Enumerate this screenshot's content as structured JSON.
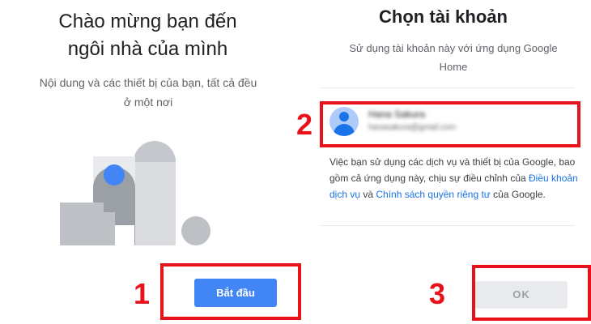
{
  "welcome": {
    "title_line1": "Chào mừng bạn đến",
    "title_line2": "ngôi nhà của mình",
    "subtitle_line1": "Nội dung và các thiết bị của bạn, tất cả đều",
    "subtitle_line2": "ở một nơi",
    "start_button": "Bắt đầu"
  },
  "choose_account": {
    "title": "Chọn tài khoản",
    "subtitle_line1": "Sử dụng tài khoản này với ứng dụng Google",
    "subtitle_line2": "Home",
    "account": {
      "name": "Hana Sakura",
      "email": "hanasakura@gmail.com"
    },
    "consent": {
      "part1": "Việc bạn sử dụng các dịch vụ và thiết bị của Google, bao gồm cả ứng dụng này, chịu sự điều chỉnh của ",
      "terms_link": "Điều khoản dịch vụ",
      "part2": " và ",
      "privacy_link": "Chính sách quyền riêng tư",
      "part3": " của Google."
    },
    "ok_button": "OK"
  },
  "annotations": {
    "step1": "1",
    "step2": "2",
    "step3": "3",
    "color": "#e8131a"
  },
  "colors": {
    "primary_blue": "#4285f4",
    "link_blue": "#1a73e8",
    "disabled_gray": "#e8eaed"
  }
}
